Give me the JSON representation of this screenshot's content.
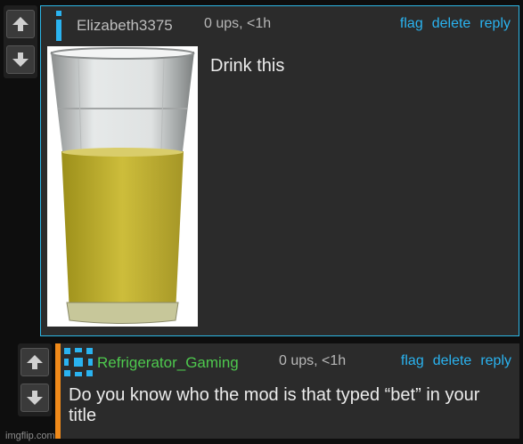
{
  "comments": [
    {
      "username": "Elizabeth3375",
      "meta": "0 ups, <1h",
      "text": "Drink this",
      "image_description": "glass-of-yellow-liquid",
      "actions": {
        "flag": "flag",
        "delete": "delete",
        "reply": "reply"
      }
    },
    {
      "username": "Refrigerator_Gaming",
      "meta": "0 ups, <1h",
      "text": "Do you know who the mod is that typed “bet” in your title",
      "actions": {
        "flag": "flag",
        "delete": "delete",
        "reply": "reply"
      }
    }
  ],
  "colors": {
    "accent_blue": "#2ab3f0",
    "username_green": "#4ec94e",
    "reply_bar_orange": "#f08a1a",
    "username_gray": "#bdbdbd"
  },
  "watermark": "imgflip.com"
}
